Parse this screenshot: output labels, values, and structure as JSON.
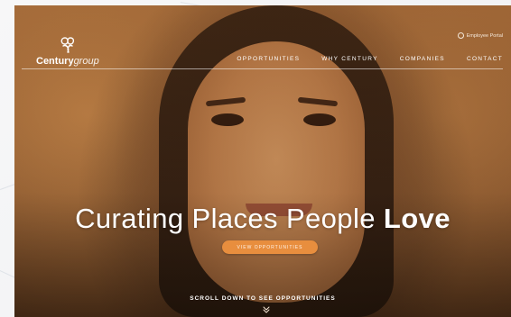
{
  "brand": {
    "name_bold": "Century",
    "name_light": "group",
    "logo_icon": "century-knot-icon"
  },
  "header": {
    "portal_label": "Employee Portal",
    "portal_icon": "user-circle-icon",
    "menu": [
      {
        "label": "OPPORTUNITIES"
      },
      {
        "label": "WHY CENTURY"
      },
      {
        "label": "COMPANIES"
      },
      {
        "label": "CONTACT"
      }
    ]
  },
  "hero": {
    "headline_prefix": "Curating Places People ",
    "headline_emphasis": "Love",
    "cta_label": "VIEW OPPORTUNITIES",
    "scroll_label": "SCROLL DOWN TO SEE OPPORTUNITIES",
    "scroll_icon": "double-chevron-down-icon"
  },
  "colors": {
    "accent": "#e88e3e",
    "text_on_hero": "#ffffff"
  }
}
